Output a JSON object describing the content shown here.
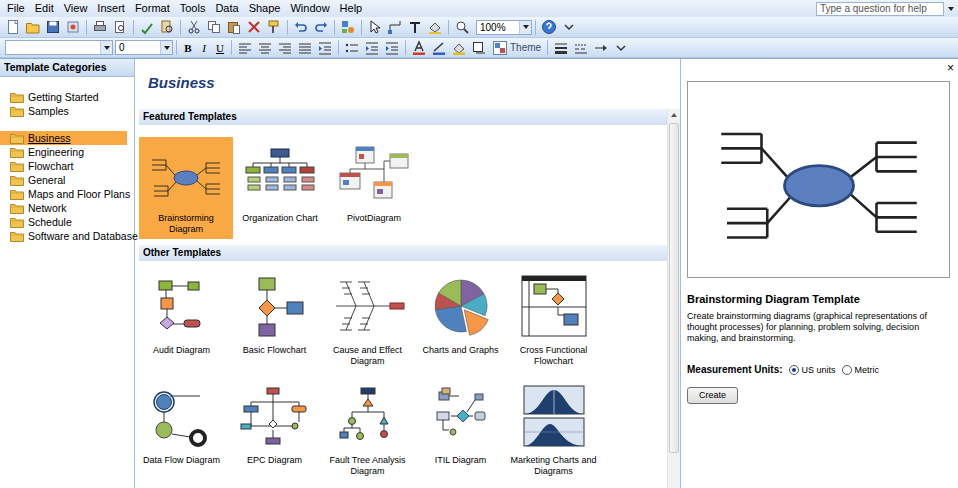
{
  "menu": [
    "File",
    "Edit",
    "View",
    "Insert",
    "Format",
    "Tools",
    "Data",
    "Shape",
    "Window",
    "Help"
  ],
  "help_box": {
    "placeholder": "Type a question for help"
  },
  "standard_toolbar": {
    "zoom": "100%"
  },
  "format_toolbar": {
    "size": "0",
    "style_buttons": [
      "B",
      "I",
      "U"
    ],
    "theme": "Theme"
  },
  "sidebar": {
    "title": "Template Categories",
    "groups": [
      [
        {
          "label": "Getting Started",
          "selected": false
        },
        {
          "label": "Samples",
          "selected": false
        }
      ],
      [
        {
          "label": "Business",
          "selected": true
        },
        {
          "label": "Engineering",
          "selected": false
        },
        {
          "label": "Flowchart",
          "selected": false
        },
        {
          "label": "General",
          "selected": false
        },
        {
          "label": "Maps and Floor Plans",
          "selected": false
        },
        {
          "label": "Network",
          "selected": false
        },
        {
          "label": "Schedule",
          "selected": false
        },
        {
          "label": "Software and Database",
          "selected": false
        }
      ]
    ]
  },
  "main": {
    "title": "Business",
    "sections": [
      {
        "title": "Featured Templates",
        "items": [
          {
            "label": "Brainstorming Diagram",
            "kind": "brainstorm",
            "selected": true
          },
          {
            "label": "Organization Chart",
            "kind": "org",
            "selected": false
          },
          {
            "label": "PivotDiagram",
            "kind": "pivot",
            "selected": false
          }
        ]
      },
      {
        "title": "Other Templates",
        "items": [
          {
            "label": "Audit Diagram",
            "kind": "audit",
            "selected": false
          },
          {
            "label": "Basic Flowchart",
            "kind": "flowchart",
            "selected": false
          },
          {
            "label": "Cause and Effect Diagram",
            "kind": "fishbone",
            "selected": false
          },
          {
            "label": "Charts and Graphs",
            "kind": "pie",
            "selected": false
          },
          {
            "label": "Cross Functional Flowchart",
            "kind": "crossfunc",
            "selected": false
          },
          {
            "label": "Data Flow Diagram",
            "kind": "dataflow",
            "selected": false
          },
          {
            "label": "EPC Diagram",
            "kind": "epc",
            "selected": false
          },
          {
            "label": "Fault Tree Analysis Diagram",
            "kind": "faulttree",
            "selected": false
          },
          {
            "label": "ITIL Diagram",
            "kind": "itil",
            "selected": false
          },
          {
            "label": "Marketing Charts and Diagrams",
            "kind": "marketing",
            "selected": false
          }
        ]
      }
    ]
  },
  "close": "×",
  "preview": {
    "title": "Brainstorming Diagram Template",
    "description": "Create brainstorming diagrams (graphical representations of thought processes) for planning, problem solving, decision making, and brainstorming.",
    "units_label": "Measurement Units:",
    "units": [
      {
        "label": "US units",
        "selected": true
      },
      {
        "label": "Metric",
        "selected": false
      }
    ],
    "button": "Create"
  }
}
